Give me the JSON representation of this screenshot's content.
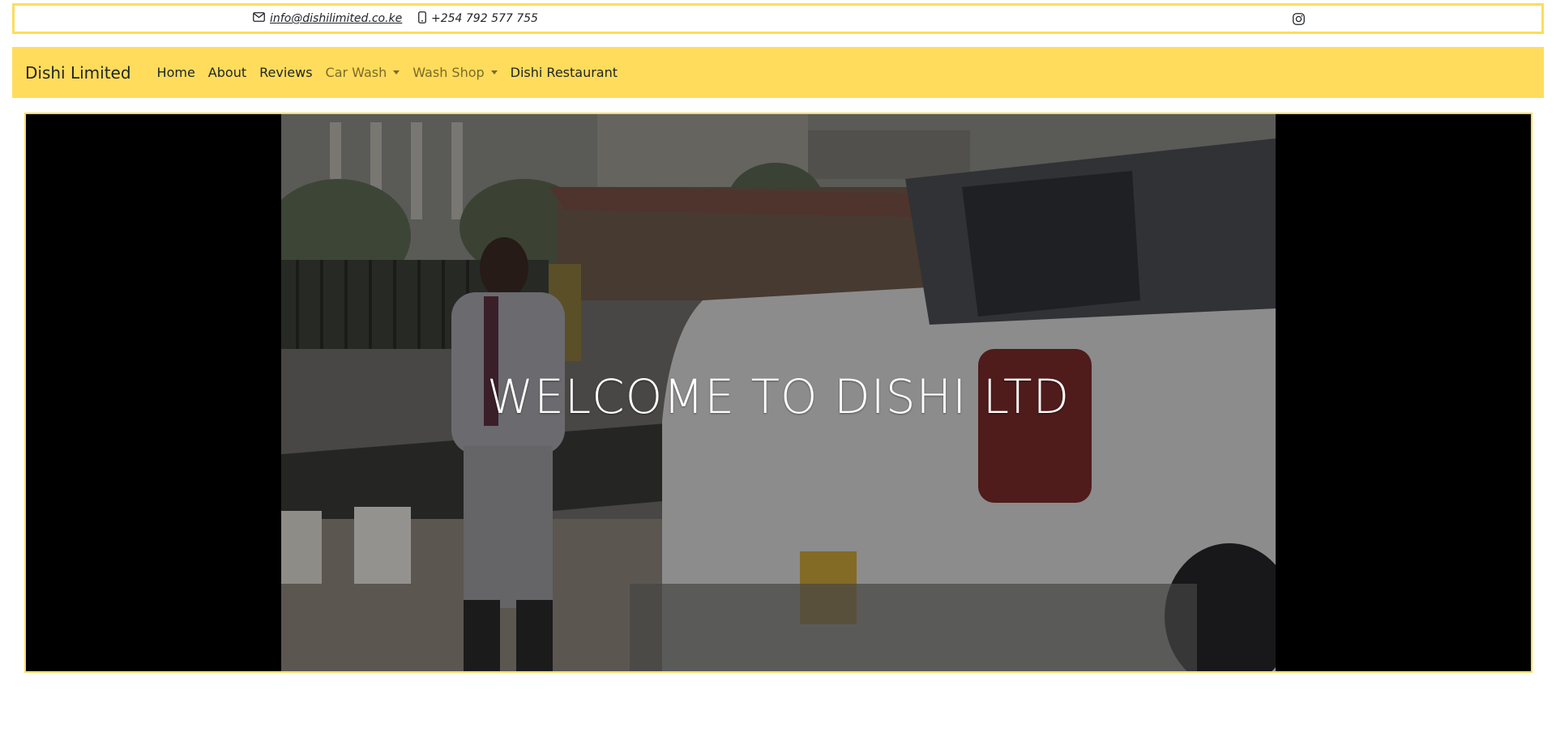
{
  "topbar": {
    "email": "info@dishilimited.co.ke",
    "phone": "+254 792 577 755",
    "email_icon": "envelope-icon",
    "phone_icon": "phone-icon",
    "social_icon": "instagram-icon"
  },
  "nav": {
    "brand": "Dishi Limited",
    "items": [
      {
        "label": "Home"
      },
      {
        "label": "About"
      },
      {
        "label": "Reviews"
      },
      {
        "label": "Car Wash",
        "dropdown": true
      },
      {
        "label": "Wash Shop",
        "dropdown": true
      },
      {
        "label": "Dishi Restaurant"
      }
    ]
  },
  "hero": {
    "title": "WELCOME TO DISHI LTD",
    "image_description_icon": "car-wash-photo"
  },
  "colors": {
    "accent": "#ffdc5c",
    "hero_bg": "#000000",
    "text": "#212529"
  }
}
